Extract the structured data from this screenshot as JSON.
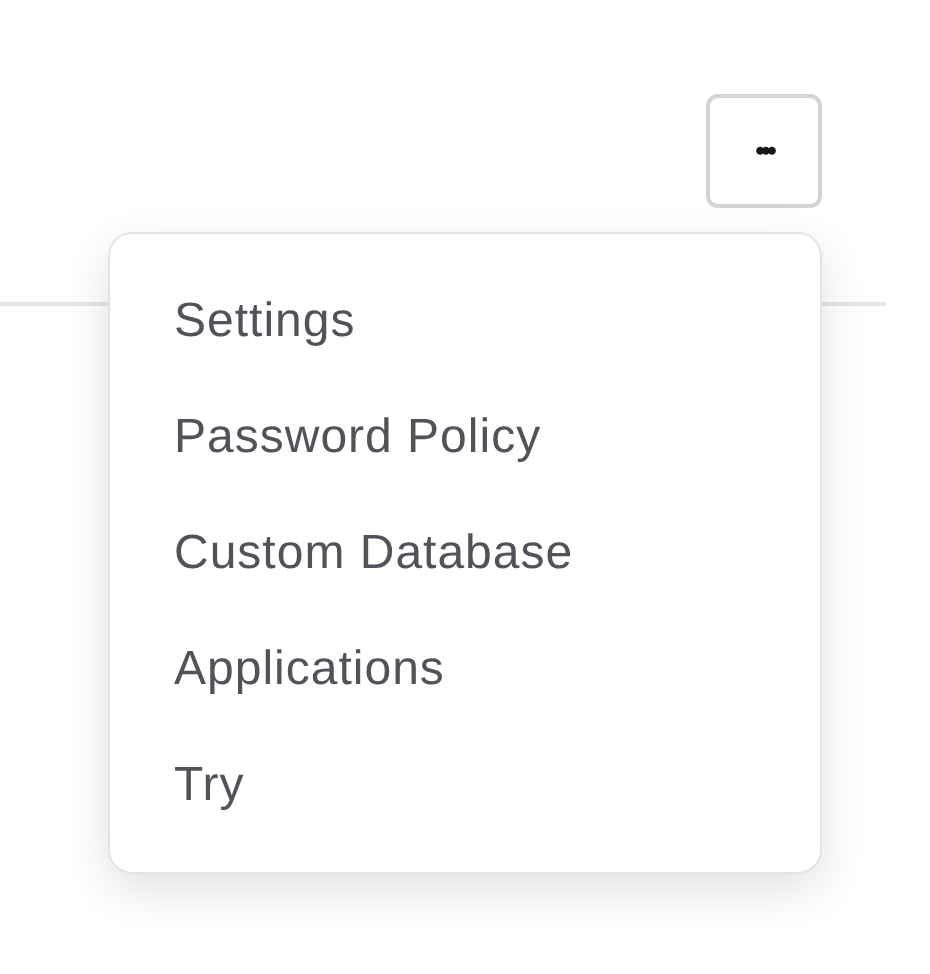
{
  "menu_button": {
    "label": "•••"
  },
  "menu": {
    "items": [
      {
        "label": "Settings"
      },
      {
        "label": "Password Policy"
      },
      {
        "label": "Custom Database"
      },
      {
        "label": "Applications"
      },
      {
        "label": "Try"
      }
    ]
  }
}
